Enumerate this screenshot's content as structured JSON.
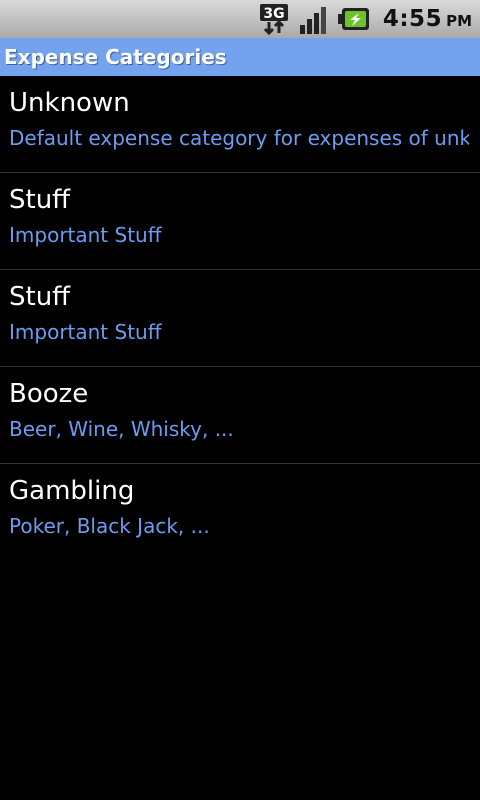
{
  "status_bar": {
    "network_label": "3G",
    "time": "4:55",
    "ampm": "PM",
    "icons": [
      "network-3g-icon",
      "signal-strength-icon",
      "battery-charging-icon"
    ]
  },
  "title_bar": {
    "title": "Expense Categories",
    "color": "#73a3ef"
  },
  "categories": [
    {
      "name": "Unknown",
      "description": "Default expense category for expenses of unknow"
    },
    {
      "name": "Stuff",
      "description": "Important Stuff"
    },
    {
      "name": "Stuff",
      "description": "Important Stuff"
    },
    {
      "name": "Booze",
      "description": "Beer, Wine, Whisky, ..."
    },
    {
      "name": "Gambling",
      "description": "Poker, Black Jack, ..."
    }
  ],
  "colors": {
    "description_text": "#6c9cf1",
    "background": "#000000",
    "battery_green": "#6fc12b"
  }
}
